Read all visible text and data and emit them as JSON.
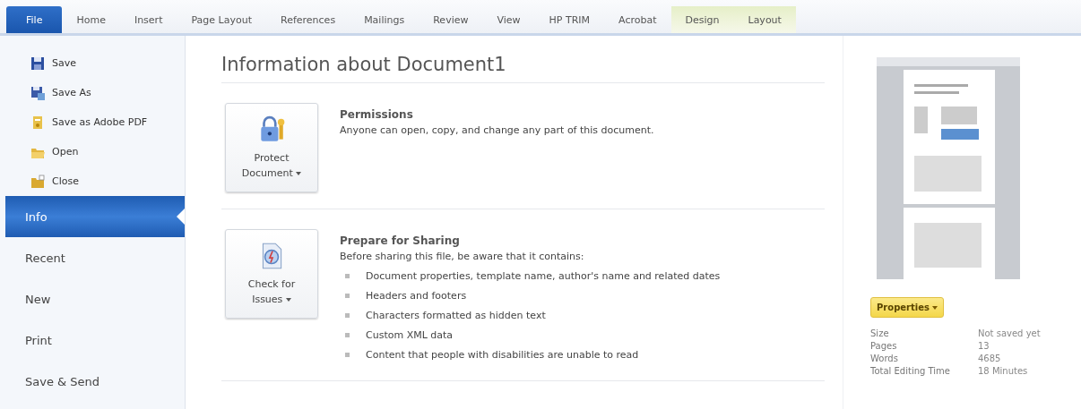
{
  "ribbon": {
    "tabs": [
      {
        "label": "File",
        "selected": true,
        "contextual": false
      },
      {
        "label": "Home",
        "selected": false,
        "contextual": false
      },
      {
        "label": "Insert",
        "selected": false,
        "contextual": false
      },
      {
        "label": "Page Layout",
        "selected": false,
        "contextual": false
      },
      {
        "label": "References",
        "selected": false,
        "contextual": false
      },
      {
        "label": "Mailings",
        "selected": false,
        "contextual": false
      },
      {
        "label": "Review",
        "selected": false,
        "contextual": false
      },
      {
        "label": "View",
        "selected": false,
        "contextual": false
      },
      {
        "label": "HP TRIM",
        "selected": false,
        "contextual": false
      },
      {
        "label": "Acrobat",
        "selected": false,
        "contextual": false
      },
      {
        "label": "Design",
        "selected": false,
        "contextual": true
      },
      {
        "label": "Layout",
        "selected": false,
        "contextual": true
      }
    ]
  },
  "sidebar": {
    "items": [
      {
        "kind": "command",
        "label": "Save",
        "selected": false
      },
      {
        "kind": "command",
        "label": "Save As",
        "selected": false
      },
      {
        "kind": "command",
        "label": "Save as Adobe PDF",
        "selected": false
      },
      {
        "kind": "command",
        "label": "Open",
        "selected": false
      },
      {
        "kind": "command",
        "label": "Close",
        "selected": false
      },
      {
        "kind": "page",
        "label": "Info",
        "selected": true
      },
      {
        "kind": "page",
        "label": "Recent",
        "selected": false
      },
      {
        "kind": "page",
        "label": "New",
        "selected": false
      },
      {
        "kind": "page",
        "label": "Print",
        "selected": false
      },
      {
        "kind": "page",
        "label": "Save & Send",
        "selected": false
      }
    ]
  },
  "main": {
    "title": "Information about Document1",
    "sections": [
      {
        "button": [
          "Protect",
          "Document"
        ],
        "heading": "Permissions",
        "text": "Anyone can open, copy, and change any part of this document."
      },
      {
        "button": [
          "Check for",
          "Issues"
        ],
        "heading": "Prepare for Sharing",
        "text": "Before sharing this file, be aware that it contains:",
        "bullets": [
          "Document properties, template name, author's name and related dates",
          "Headers and footers",
          "Characters formatted as hidden text",
          "Custom XML data",
          "Content that people with disabilities are unable to read"
        ]
      }
    ]
  },
  "properties": {
    "button": "Properties",
    "rows": [
      {
        "label": "Size",
        "value": "Not saved yet"
      },
      {
        "label": "Pages",
        "value": "13"
      },
      {
        "label": "Words",
        "value": "4685"
      },
      {
        "label": "Total Editing Time",
        "value": "18 Minutes"
      }
    ]
  }
}
